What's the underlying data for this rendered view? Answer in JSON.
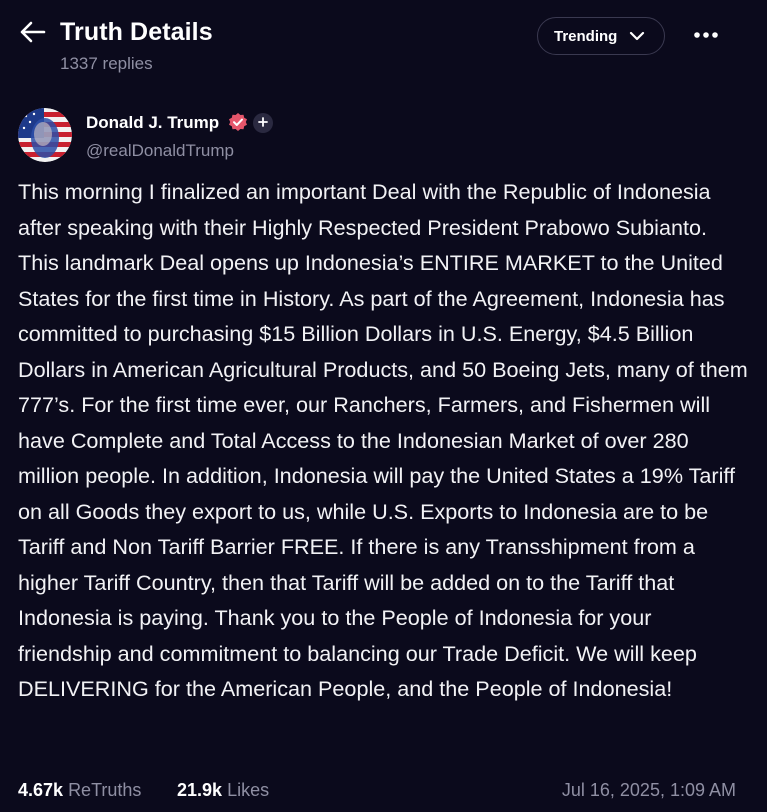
{
  "header": {
    "title": "Truth Details",
    "replies": "1337 replies",
    "sort_label": "Trending"
  },
  "author": {
    "name": "Donald J. Trump",
    "handle": "@realDonaldTrump"
  },
  "post": {
    "text": "This morning I finalized an important Deal with the Republic of Indonesia after speaking with their Highly Respected President Prabowo Subianto. This landmark Deal opens up Indonesia’s ENTIRE MARKET to the United States for the first time in History. As part of the Agreement, Indonesia has committed to purchasing $15 Billion Dollars in U.S. Energy, $4.5 Billion Dollars in American Agricultural Products, and 50 Boeing Jets, many of them 777’s. For the first time ever, our Ranchers, Farmers, and Fishermen will have Complete and Total Access to the Indonesian Market of over 280 million people. In addition, Indonesia will pay the United States a 19% Tariff on all Goods they export to us, while U.S. Exports to Indonesia are to be Tariff and Non Tariff Barrier FREE. If there is any Transshipment from a higher Tariff Country, then that Tariff will be added on to the Tariff that Indonesia is paying. Thank you to the People of Indonesia for your friendship and commitment to balancing our Trade Deficit. We will keep DELIVERING for the American People, and the People of Indonesia!"
  },
  "stats": {
    "retruths_count": "4.67k",
    "retruths_label": "ReTruths",
    "likes_count": "21.9k",
    "likes_label": "Likes",
    "timestamp": "Jul 16, 2025, 1:09 AM"
  },
  "icons": {
    "back": "back-arrow-icon",
    "chevron": "chevron-down-icon",
    "more": "more-horizontal-icon",
    "verified": "verified-badge-icon",
    "follow": "plus-icon"
  },
  "colors": {
    "background": "#0b0a1c",
    "secondary_text": "#8f8fa3",
    "verified_badge": "#e5566b"
  }
}
